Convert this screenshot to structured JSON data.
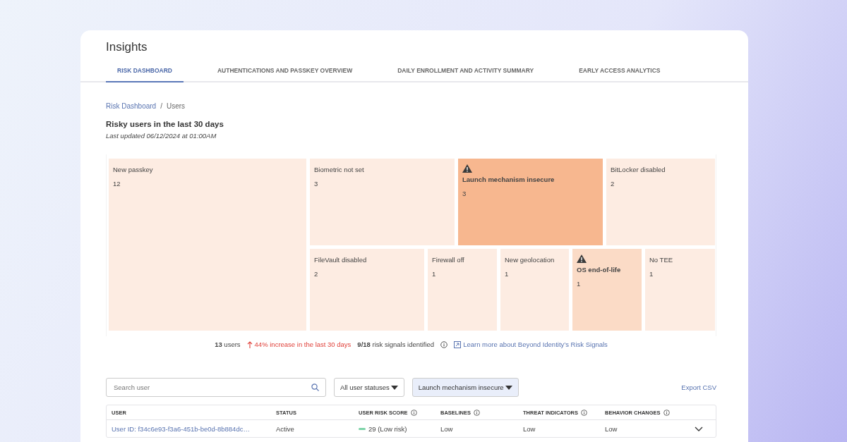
{
  "page": {
    "title": "Insights"
  },
  "tabs": [
    {
      "label": "RISK DASHBOARD",
      "selected": true
    },
    {
      "label": "AUTHENTICATIONS AND PASSKEY OVERVIEW",
      "selected": false
    },
    {
      "label": "DAILY ENROLLMENT AND ACTIVITY SUMMARY",
      "selected": false
    },
    {
      "label": "EARLY ACCESS ANALYTICS",
      "selected": false
    }
  ],
  "breadcrumb": {
    "items": [
      "Risk Dashboard",
      "Users"
    ],
    "separator": "/"
  },
  "heading": "Risky users in the last 30 days",
  "updated": "Last updated 06/12/2024 at 01:00AM",
  "treemap": [
    {
      "label": "New passkey",
      "count": "12",
      "warning": false,
      "color": "#fdece2"
    },
    {
      "label": "Biometric not set",
      "count": "3",
      "warning": false,
      "color": "#fdece2"
    },
    {
      "label": "Launch mechanism insecure",
      "count": "3",
      "warning": true,
      "color": "#f7b78f"
    },
    {
      "label": "BitLocker disabled",
      "count": "2",
      "warning": false,
      "color": "#fdece2"
    },
    {
      "label": "FileVault disabled",
      "count": "2",
      "warning": false,
      "color": "#fdece2"
    },
    {
      "label": "Firewall off",
      "count": "1",
      "warning": false,
      "color": "#fdece2"
    },
    {
      "label": "New geolocation",
      "count": "1",
      "warning": false,
      "color": "#fdece2"
    },
    {
      "label": "OS end-of-life",
      "count": "1",
      "warning": true,
      "color": "#fbdbc6"
    },
    {
      "label": "No TEE",
      "count": "1",
      "warning": false,
      "color": "#fdece2"
    }
  ],
  "summary": {
    "users": "**13** users",
    "increase": "44% increase in the last 30 days",
    "signals": "**9/18** risk signals identified",
    "link": "Learn more about Beyond Identity’s Risk Signals"
  },
  "search": {
    "placeholder": "Search user"
  },
  "filters": [
    {
      "label": "All user statuses",
      "active": false
    },
    {
      "label": "Launch mechanism insecure",
      "active": true
    }
  ],
  "export": "Export CSV",
  "table": {
    "columns": [
      {
        "label": "USER",
        "info": false
      },
      {
        "label": "STATUS",
        "info": false
      },
      {
        "label": "USER RISK SCORE",
        "info": true
      },
      {
        "label": "BASELINES",
        "info": true
      },
      {
        "label": "THREAT INDICATORS",
        "info": true
      },
      {
        "label": "BEHAVIOR CHANGES",
        "info": true
      }
    ],
    "rows": [
      {
        "user": "User ID: f34c6e93-f3a6-451b-be0d-8b884dc…",
        "status": "Active",
        "score": "29 (Low risk)",
        "baselines": "Low",
        "threats": "Low",
        "behavior": "Low",
        "expanded": false
      }
    ]
  }
}
